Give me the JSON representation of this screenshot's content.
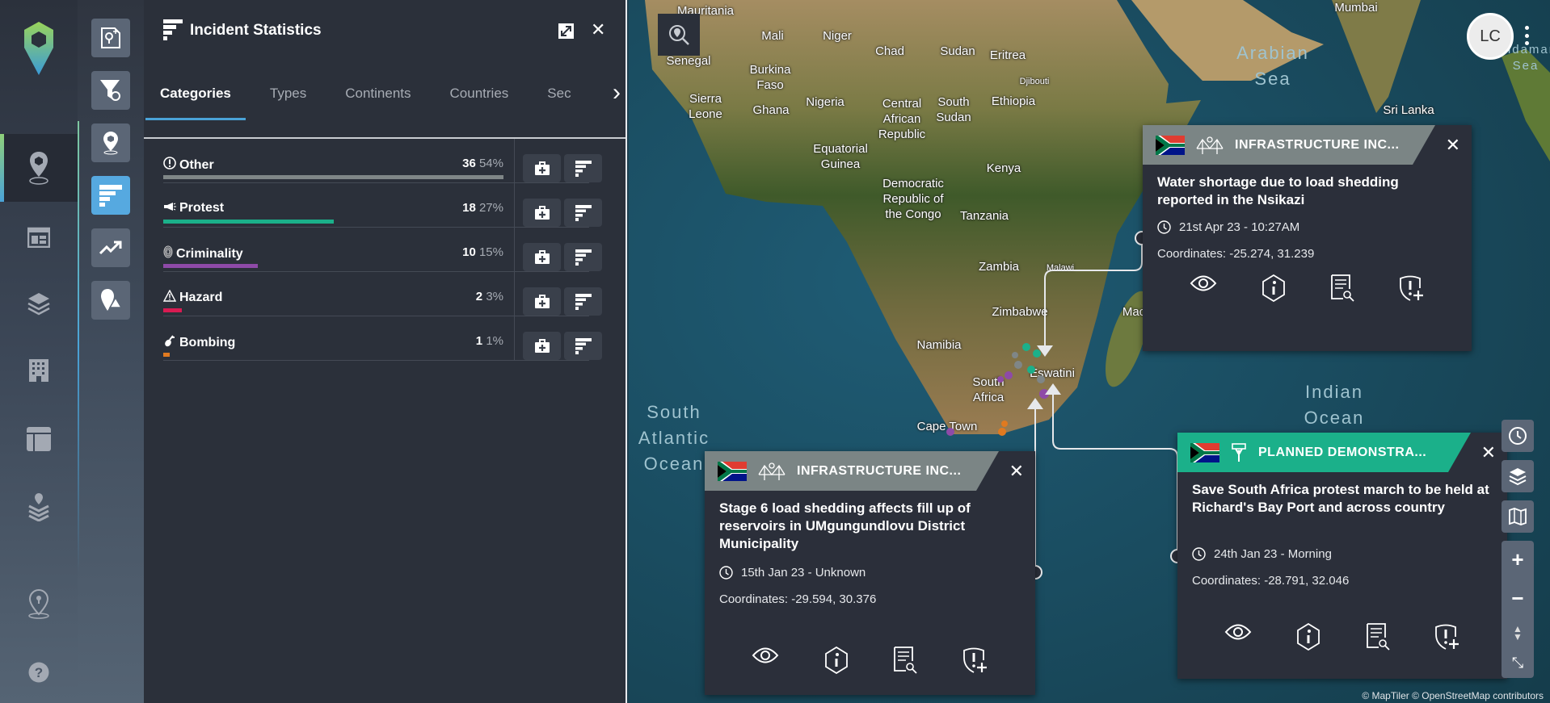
{
  "panel": {
    "title": "Incident Statistics",
    "tabs": [
      "Categories",
      "Types",
      "Continents",
      "Countries",
      "Sectors"
    ],
    "active_tab": "Categories",
    "rows": [
      {
        "label": "Other",
        "count": "36",
        "percent": "54%",
        "pct": 54,
        "color": "#7f8687",
        "icon": "exclamation-circle-icon"
      },
      {
        "label": "Protest",
        "count": "18",
        "percent": "27%",
        "pct": 27,
        "color": "#1bb08a",
        "icon": "megaphone-icon"
      },
      {
        "label": "Criminality",
        "count": "10",
        "percent": "15%",
        "pct": 15,
        "color": "#8e4aa8",
        "icon": "fingerprint-icon"
      },
      {
        "label": "Hazard",
        "count": "2",
        "percent": "3%",
        "pct": 3,
        "color": "#d81b52",
        "icon": "warning-triangle-icon"
      },
      {
        "label": "Bombing",
        "count": "1",
        "percent": "1%",
        "pct": 1,
        "color": "#e07a20",
        "icon": "bomb-icon"
      }
    ]
  },
  "user": {
    "initials": "LC"
  },
  "map": {
    "labels": {
      "mauritania": "Mauritania",
      "mali": "Mali",
      "niger": "Niger",
      "chad": "Chad",
      "sudan": "Sudan",
      "eritrea": "Eritrea",
      "senegal": "Senegal",
      "burkina": "Burkina\nFaso",
      "sierra": "Sierra\nLeone",
      "ghana": "Ghana",
      "nigeria": "Nigeria",
      "car": "Central\nAfrican\nRepublic",
      "ssudan": "South\nSudan",
      "ethiopia": "Ethiopia",
      "djibouti": "Djibouti",
      "eqguinea": "Equatorial\nGuinea",
      "kenya": "Kenya",
      "drc": "Democratic\nRepublic of\nthe Congo",
      "tanzania": "Tanzania",
      "zambia": "Zambia",
      "malawi": "Malawi",
      "zimbabwe": "Zimbabwe",
      "namibia": "Namibia",
      "southafrica": "South\nAfrica",
      "eswatini": "Eswatini",
      "capetown": "Cape Town",
      "madagascar": "Mac",
      "srilanka": "Sri Lanka",
      "mumbai": "Mumbai"
    },
    "oceans": {
      "arabian": "Arabian\nSea",
      "indian": "Indian\nOcean",
      "satlantic": "South\nAtlantic\nOcean",
      "andaman": "Andaman\nSea"
    },
    "attribution": "© MapTiler © OpenStreetMap contributors"
  },
  "cards": [
    {
      "category": "INFRASTRUCTURE INC...",
      "header_color": "#7b8585",
      "title": "Water shortage due to load shedding reported in the Nsikazi",
      "time": "21st Apr 23 - 10:27AM",
      "coordinates": "Coordinates: -25.274, 31.239"
    },
    {
      "category": "INFRASTRUCTURE INC...",
      "header_color": "#7b8585",
      "title": "Stage 6 load shedding affects fill up of reservoirs in UMgungundlovu District Municipality",
      "time": "15th Jan 23 - Unknown",
      "coordinates": "Coordinates: -29.594, 30.376"
    },
    {
      "category": "PLANNED DEMONSTRA...",
      "header_color": "#1bb08a",
      "title": "Save South Africa protest march to be held at Richard's Bay Port and across country",
      "time": "24th Jan 23 - Morning",
      "coordinates": "Coordinates: -28.791, 32.046"
    }
  ]
}
